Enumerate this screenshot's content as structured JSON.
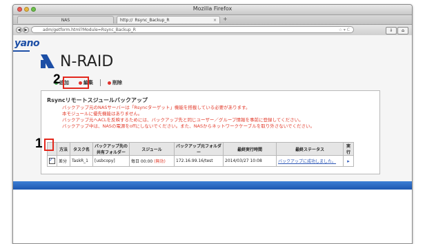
{
  "browser": {
    "window_title": "Mozilla Firefox",
    "tabs": [
      {
        "label": "NAS"
      },
      {
        "label": "http://",
        "url_suffix": "Rsync_Backup_R"
      }
    ],
    "new_tab": "+",
    "url": "adm/getform.html?Module=Rsync_Backup_R"
  },
  "brand": {
    "company": "yano",
    "product": "N-RAID"
  },
  "menu": {
    "add_label": "追加",
    "edit_label": "編集",
    "delete_label": "削除"
  },
  "annotations": {
    "step1": "1",
    "step2": "2"
  },
  "panel": {
    "title": "Rsyncリモートスジュールバックアップ",
    "notes": [
      "バックアップ元のNASサーバーは「Rsyncターゲット」機能を搭載している必要があります。",
      "本モジュールに優先機能はありません。",
      "バックアップ元へACLを反映するためには、バックアップ先と同じユーザー／グループ情報を事前に登録してください。",
      "バックアップ中は、NASの電源をoffにしないでください。また、NASからネットワークケーブルを取り外さないでください。"
    ]
  },
  "table": {
    "headers": [
      "",
      "方法",
      "タスク名",
      "バックアップ先の共有フォルダー",
      "スジュール",
      "バックアップ元フォルダー",
      "最終実行時間",
      "最終ステータス",
      "実行"
    ],
    "rows": [
      {
        "method": "差分",
        "task": "TaskR_1",
        "dest_folder": "[usbcopy]",
        "schedule": "毎日 00:00",
        "schedule_flag": "(無効)",
        "source_folder": "172.16.99.16/test",
        "last_run": "2014/03/27 10:08",
        "status": "バックアップに成功しました。"
      }
    ]
  },
  "colors": {
    "accent_blue": "#1d57b0",
    "annotation_red": "#e3261b",
    "notice_red": "#e23a2a"
  }
}
